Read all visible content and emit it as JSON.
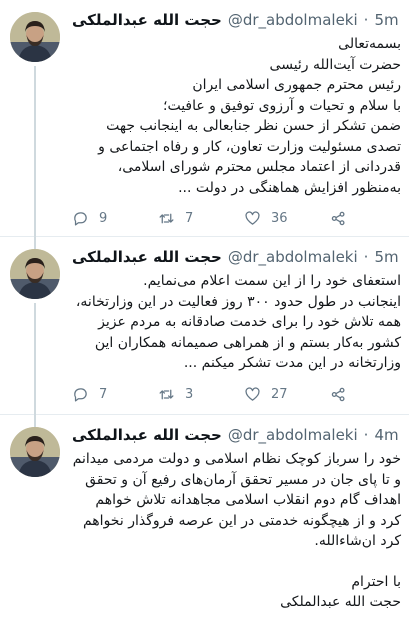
{
  "author": {
    "name": "حجت الله عبدالملکی",
    "handle": "@dr_abdolmaleki"
  },
  "tweets": [
    {
      "time": "5m",
      "lines": [
        "بسمه‌تعالی",
        "حضرت آیت‌الله رئیسی",
        "رئیس محترم جمهوری اسلامی ایران",
        "با سلام و تحیات و آرزوی توفیق و عافیت؛",
        "ضمن تشکر از حسن نظر جنابعالی به اینجانب جهت",
        "تصدی مسئولیت وزارت تعاون، کار و رفاه اجتماعی و",
        "قدردانی از اعتماد مجلس محترم شورای اسلامی،",
        "به‌منظور افزایش هماهنگی در دولت ..."
      ],
      "replies": "9",
      "retweets": "7",
      "likes": "36"
    },
    {
      "time": "5m",
      "lines": [
        "استعفای خود را از این سمت اعلام می‌نمایم.",
        "اینجانب در طول حدود ۳۰۰ روز فعالیت در این وزارتخانه،",
        "همه تلاش خود را برای خدمت صادقانه به مردم عزیز",
        "کشور به‌کار بستم و از همراهی صمیمانه همکاران این",
        "وزارتخانه در این مدت تشکر میکنم ..."
      ],
      "replies": "7",
      "retweets": "3",
      "likes": "27"
    },
    {
      "time": "4m",
      "lines": [
        "خود را سرباز کوچک نظام اسلامی و دولت مردمی میدانم",
        "و تا پای جان در مسیر تحقق آرمان‌های رفیع آن و تحقق",
        "اهداف گام دوم انقلاب اسلامی مجاهدانه تلاش خواهم",
        "کرد و از هیچگونه خدمتی در این عرصه فروگذار نخواهم",
        "کرد ان‌شاءالله."
      ],
      "closing": [
        "با احترام",
        "حجت الله عبدالملکی"
      ]
    }
  ],
  "icons": {
    "reply": "speech-bubble-icon",
    "retweet": "retweet-arrows-icon",
    "like": "heart-icon",
    "share": "share-nodes-icon",
    "more": "chevron-down-icon"
  },
  "colors": {
    "text": "#14171a",
    "meta": "#536471",
    "divider": "#e6ecf0",
    "thread_line": "#cfd9de",
    "icon": "#657786"
  }
}
